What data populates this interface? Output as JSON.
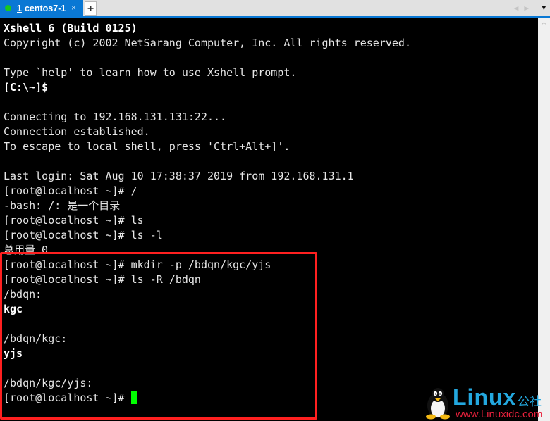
{
  "tabbar": {
    "tab": {
      "number": "1",
      "label": "centos7-1",
      "status_color": "#19c81e",
      "close_glyph": "×"
    },
    "new_tab_glyph": "+",
    "nav_prev_glyph": "◀",
    "nav_next_glyph": "▶",
    "menu_glyph": "▼"
  },
  "terminal": {
    "lines": [
      {
        "text": "Xshell 6 (Build 0125)",
        "bold": true
      },
      {
        "text": "Copyright (c) 2002 NetSarang Computer, Inc. All rights reserved.",
        "bold": false
      },
      {
        "text": "",
        "bold": false
      },
      {
        "text": "Type `help' to learn how to use Xshell prompt.",
        "bold": false
      },
      {
        "text": "[C:\\~]$",
        "bold": true
      },
      {
        "text": "",
        "bold": false
      },
      {
        "text": "Connecting to 192.168.131.131:22...",
        "bold": false
      },
      {
        "text": "Connection established.",
        "bold": false
      },
      {
        "text": "To escape to local shell, press 'Ctrl+Alt+]'.",
        "bold": false
      },
      {
        "text": "",
        "bold": false
      },
      {
        "text": "Last login: Sat Aug 10 17:38:37 2019 from 192.168.131.1",
        "bold": false
      },
      {
        "text": "[root@localhost ~]# /",
        "bold": false
      },
      {
        "text": "-bash: /: 是一个目录",
        "bold": false
      },
      {
        "text": "[root@localhost ~]# ls",
        "bold": false
      },
      {
        "text": "[root@localhost ~]# ls -l",
        "bold": false
      },
      {
        "text": "总用量 0",
        "bold": false
      },
      {
        "text": "[root@localhost ~]# mkdir -p /bdqn/kgc/yjs",
        "bold": false
      },
      {
        "text": "[root@localhost ~]# ls -R /bdqn",
        "bold": false
      },
      {
        "text": "/bdqn:",
        "bold": false
      },
      {
        "text": "kgc",
        "bold": true
      },
      {
        "text": "",
        "bold": false
      },
      {
        "text": "/bdqn/kgc:",
        "bold": false
      },
      {
        "text": "yjs",
        "bold": true
      },
      {
        "text": "",
        "bold": false
      },
      {
        "text": "/bdqn/kgc/yjs:",
        "bold": false
      }
    ],
    "prompt": "[root@localhost ~]# ",
    "cursor_color": "#00ff00"
  },
  "scrollbar": {
    "up_glyph": "^"
  },
  "annotation": {
    "color": "#ff2020"
  },
  "watermark": {
    "brand": "Linux",
    "brand_cn": "公社",
    "url": "www.Linuxidc.com"
  }
}
